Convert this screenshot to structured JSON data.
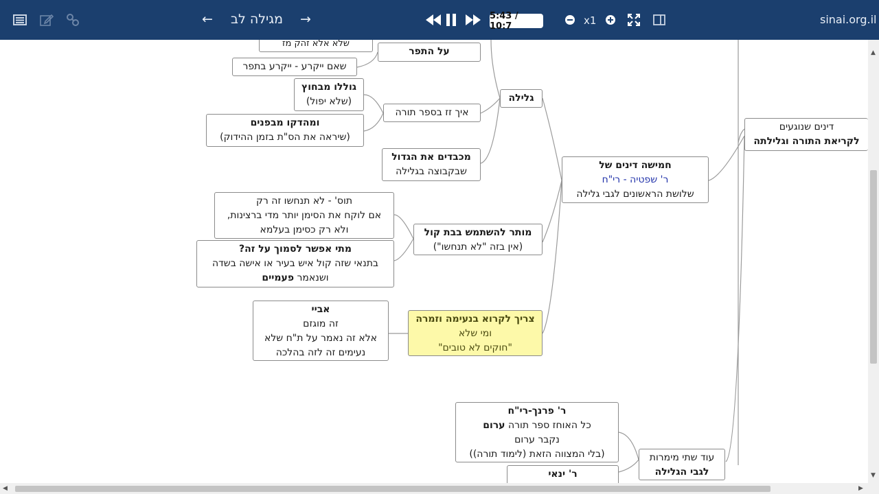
{
  "toolbar": {
    "title": "מגילה לב",
    "prev_arrow": "←",
    "next_arrow": "→",
    "time": "5:43 / 10:7",
    "speed": "x1",
    "site": "sinai.org.il",
    "icons": [
      "menu-icon",
      "edit-icon",
      "link-icon",
      "rewind-icon",
      "pause-icon",
      "fast-forward-icon",
      "minus-icon",
      "plus-icon",
      "fullscreen-icon",
      "split-view-icon"
    ]
  },
  "nodes": {
    "top_partial": "שלא אלא זהק מז",
    "al_hatefer": "על התפר",
    "sheam_yikra": "שאם ייקרע - ייקרע בתפר",
    "gollo_mibahutz": "גוללו מבחוץ",
    "shelo_yipol": "(שלא יפול)",
    "umehadko_mibifnim": "ומהדקו מבפנים",
    "sheyire": "(שיראה את הס\"ת בזמן ההידוק)",
    "eich_zaz": "איך זז בספר תורה",
    "gelila": "גלילה",
    "mechabdim": "מכבדים את הגדול",
    "shebikvutza": "שבקבוצה בגלילה",
    "tosfot_1": "תוס' - לא תנחשו זה רק",
    "tosfot_2": "אם לוקח את הסימן יותר מדי ברצינות,",
    "tosfot_3": "ולא רק כסימן בעלמא",
    "mutar_1": "מותר להשתמש בבת קול",
    "mutar_2": "(אין בזה \"לא תנחשו\")",
    "matai_1": "מתי אפשר לסמוך על זה?",
    "matai_2": "בתנאי שזה קול איש בעיר או אישה בשדה",
    "matai_3a": "ושנאמר ",
    "matai_3b": "פעמיים",
    "chamisha_1": "חמישה דינים של",
    "chamisha_2": "ר' שפטיה - רי\"ח",
    "chamisha_3": "שלושת הראשונים לגבי גלילה",
    "dinim_1": "דינים שנוגעים",
    "dinim_2": "לקריאת התורה וגלילתה",
    "abaye_1": "אביי",
    "abaye_2": "זה מוגזם",
    "abaye_3": "אלא זה נאמר על ת\"ח שלא",
    "abaye_4": "נעימים זה לזה בהלכה",
    "tzarich_1": "צריך לקרוא בנעימה וזמרה",
    "tzarich_2": "ומי שלא",
    "tzarich_3": "\"חוקים לא טובים\"",
    "parnach_1": "ר' פרנך-רי\"ח",
    "parnach_2a": "כל האוחז ספר תורה ",
    "parnach_2b": "ערום",
    "parnach_3": "נקבר ערום",
    "parnach_4": "(בלי המצווה הזאת (לימוד תורה))",
    "od_1": "עוד שתי מימרות",
    "od_2": "לגבי הגלילה",
    "yanai": "ר' ינאי"
  },
  "colors": {
    "toolbar_bg": "#1b3f6e",
    "highlight_node": "#fdf9a9",
    "link": "#9a9a9a",
    "blue_text": "#2233aa"
  }
}
